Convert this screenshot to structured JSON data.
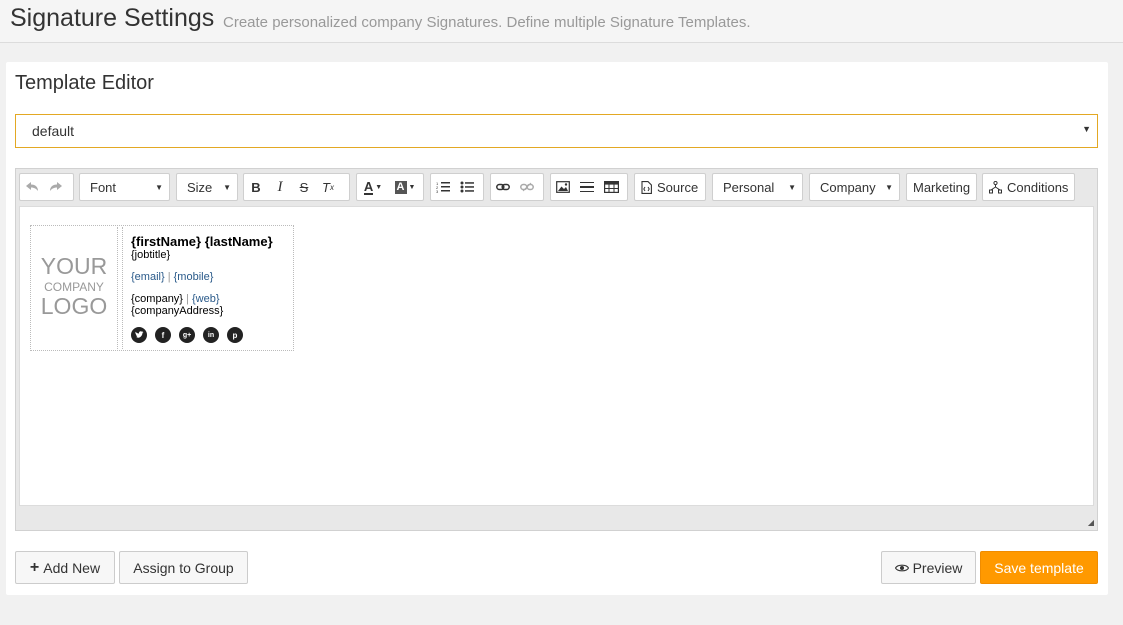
{
  "header": {
    "title": "Signature Settings",
    "subtitle": "Create personalized company Signatures. Define multiple Signature Templates."
  },
  "panel": {
    "title": "Template Editor",
    "template_select": {
      "value": "default"
    }
  },
  "toolbar": {
    "font_label": "Font",
    "size_label": "Size",
    "source_label": "Source",
    "personal_label": "Personal",
    "company_label": "Company",
    "marketing_label": "Marketing",
    "conditions_label": "Conditions"
  },
  "signature": {
    "logo": {
      "line1": "YOUR",
      "line2": "COMPANY",
      "line3": "LOGO"
    },
    "first_name": "{firstName}",
    "last_name": "{lastName}",
    "jobtitle": "{jobtitle}",
    "email": "{email}",
    "mobile": "{mobile}",
    "separator": "|",
    "company": "{company}",
    "web": "{web}",
    "company_address": "{companyAddress}",
    "socials": [
      "twitter-icon",
      "facebook-icon",
      "google-plus-icon",
      "linkedin-icon",
      "pinterest-icon"
    ]
  },
  "actions": {
    "add_new": "Add New",
    "assign_to_group": "Assign to Group",
    "preview": "Preview",
    "save_template": "Save template"
  },
  "colors": {
    "accent": "#ff9900",
    "select_border": "#e3a823",
    "link": "#2a5a8a"
  }
}
